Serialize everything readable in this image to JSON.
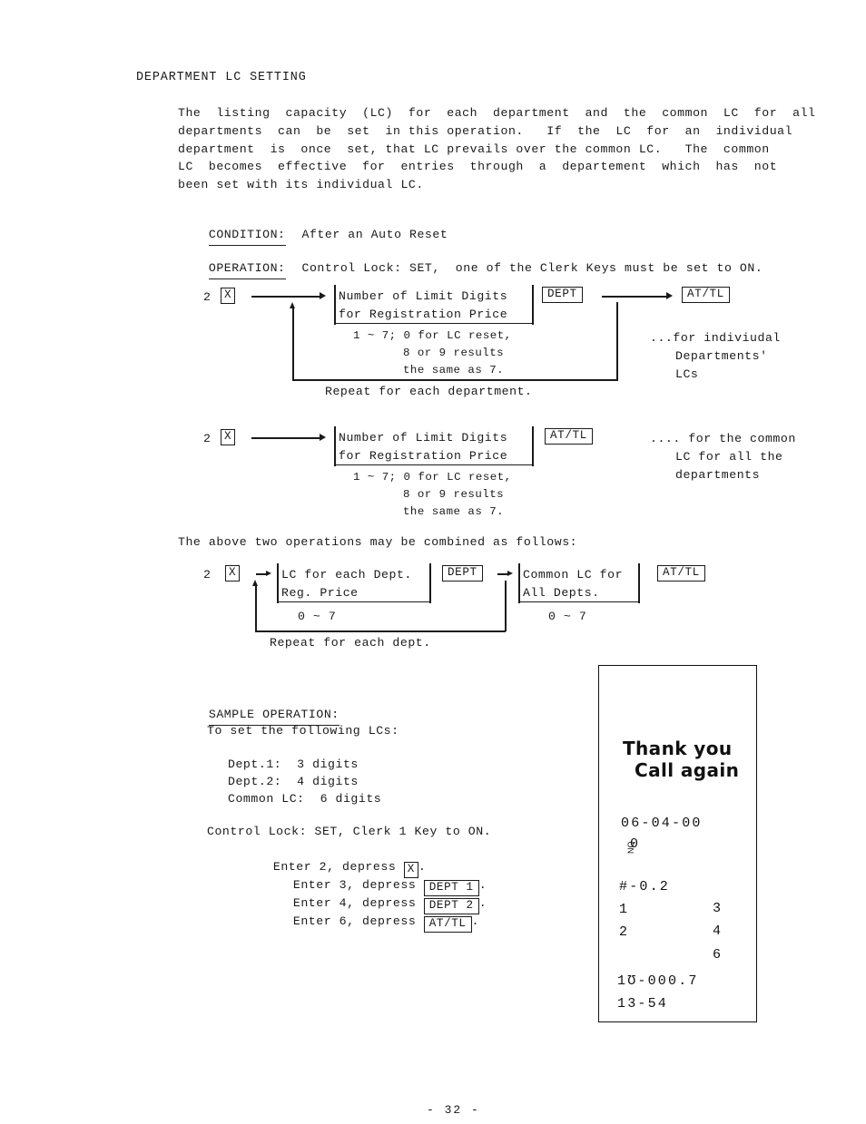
{
  "document": {
    "heading": "DEPARTMENT LC SETTING",
    "page_number": "- 32 -"
  },
  "intro": {
    "lines": [
      "The  listing  capacity  (LC)  for  each  department  and  the  common  LC  for  all",
      "departments  can  be  set  in this operation.   If  the  LC  for  an  individual",
      "department  is  once  set, that LC prevails over the common LC.   The  common",
      "LC  becomes  effective  for  entries  through  a  departement  which  has  not",
      "been set with its individual LC."
    ]
  },
  "condition": {
    "label": "CONDITION:",
    "value": "After an Auto Reset"
  },
  "operation": {
    "label": "OPERATION:",
    "value": "Control Lock: SET,  one of the Clerk Keys must be set to ON."
  },
  "flow1": {
    "start_digit": "2",
    "start_key": "X",
    "box_line1": "Number of Limit Digits",
    "box_line2": "for Registration Price",
    "note1": "1 ~ 7; 0 for LC reset,",
    "note2": "8 or 9 results",
    "note3": "the same as 7.",
    "key_dept": "DEPT",
    "key_attl": "AT/TL",
    "loop_label": "Repeat for each department.",
    "annotation": [
      "...for indiviudal",
      "Departments'",
      "LCs"
    ]
  },
  "flow2": {
    "start_digit": "2",
    "start_key": "X",
    "box_line1": "Number of Limit Digits",
    "box_line2": "for Registration Price",
    "note1": "1 ~ 7; 0 for LC reset,",
    "note2": "8 or 9 results",
    "note3": "the same as 7.",
    "key_attl": "AT/TL",
    "annotation": [
      ".... for the common",
      "LC for all the",
      "departments"
    ]
  },
  "combined": {
    "intro": "The above two operations may be combined as follows:",
    "start_digit": "2",
    "start_key": "X",
    "box1_line1": "LC for each Dept.",
    "box1_line2": "Reg. Price",
    "box1_range": "0 ~ 7",
    "key_dept": "DEPT",
    "box2_line1": "Common LC for",
    "box2_line2": "All Depts.",
    "box2_range": "0 ~ 7",
    "key_attl": "AT/TL",
    "loop_label": "Repeat for each dept."
  },
  "sample": {
    "title": "SAMPLE OPERATION:",
    "lead": "To set the following LCs:",
    "settings": [
      "Dept.1:  3 digits",
      "Dept.2:  4 digits",
      "Common LC:  6 digits"
    ],
    "control_lock": "Control Lock: SET, Clerk 1 Key to ON.",
    "steps": [
      {
        "pre": "Enter 2, depress ",
        "key": "X",
        "post": "."
      },
      {
        "pre": "Enter 3, depress ",
        "key": "DEPT 1",
        "post": "."
      },
      {
        "pre": "Enter 4, depress ",
        "key": "DEPT 2",
        "post": "."
      },
      {
        "pre": "Enter 6, depress ",
        "key": "AT/TL",
        "post": "."
      }
    ]
  },
  "receipt": {
    "greeting_line1": "Thank you",
    "greeting_line2": "Call again",
    "date": "06-04-00",
    "no_label": "NO",
    "no_value": "0",
    "rows": [
      {
        "left": "#-0.2",
        "right": ""
      },
      {
        "left": "1",
        "right": "3"
      },
      {
        "left": "2",
        "right": "4"
      },
      {
        "left": "",
        "right": "6"
      }
    ],
    "total_line": "1Ʊ-000.7",
    "time_line": "13-54"
  }
}
